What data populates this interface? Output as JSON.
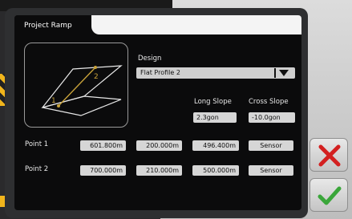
{
  "window": {
    "title": "Project Ramp"
  },
  "diagram": {
    "point_labels": [
      "1",
      "2"
    ]
  },
  "design": {
    "label": "Design",
    "selected": "Flat Profile 2",
    "dropdown_icon": "triangle-down-icon"
  },
  "slopes": {
    "long_label": "Long Slope",
    "cross_label": "Cross Slope",
    "long_value": "2.3gon",
    "cross_value": "-10.0gon"
  },
  "points": [
    {
      "label": "Point 1",
      "values": [
        "601.800m",
        "200.000m",
        "496.400m"
      ],
      "sensor_label": "Sensor"
    },
    {
      "label": "Point 2",
      "values": [
        "700.000m",
        "210.000m",
        "500.000m"
      ],
      "sensor_label": "Sensor"
    }
  ],
  "side_buttons": {
    "cancel_icon": "x-icon",
    "confirm_icon": "checkmark-icon",
    "cancel_color": "#d32020",
    "confirm_color": "#3aa63a"
  },
  "colors": {
    "screen_bg": "#0b0b0c",
    "field_bg": "#d6d6d6",
    "diagram_line": "#c8a23a"
  }
}
